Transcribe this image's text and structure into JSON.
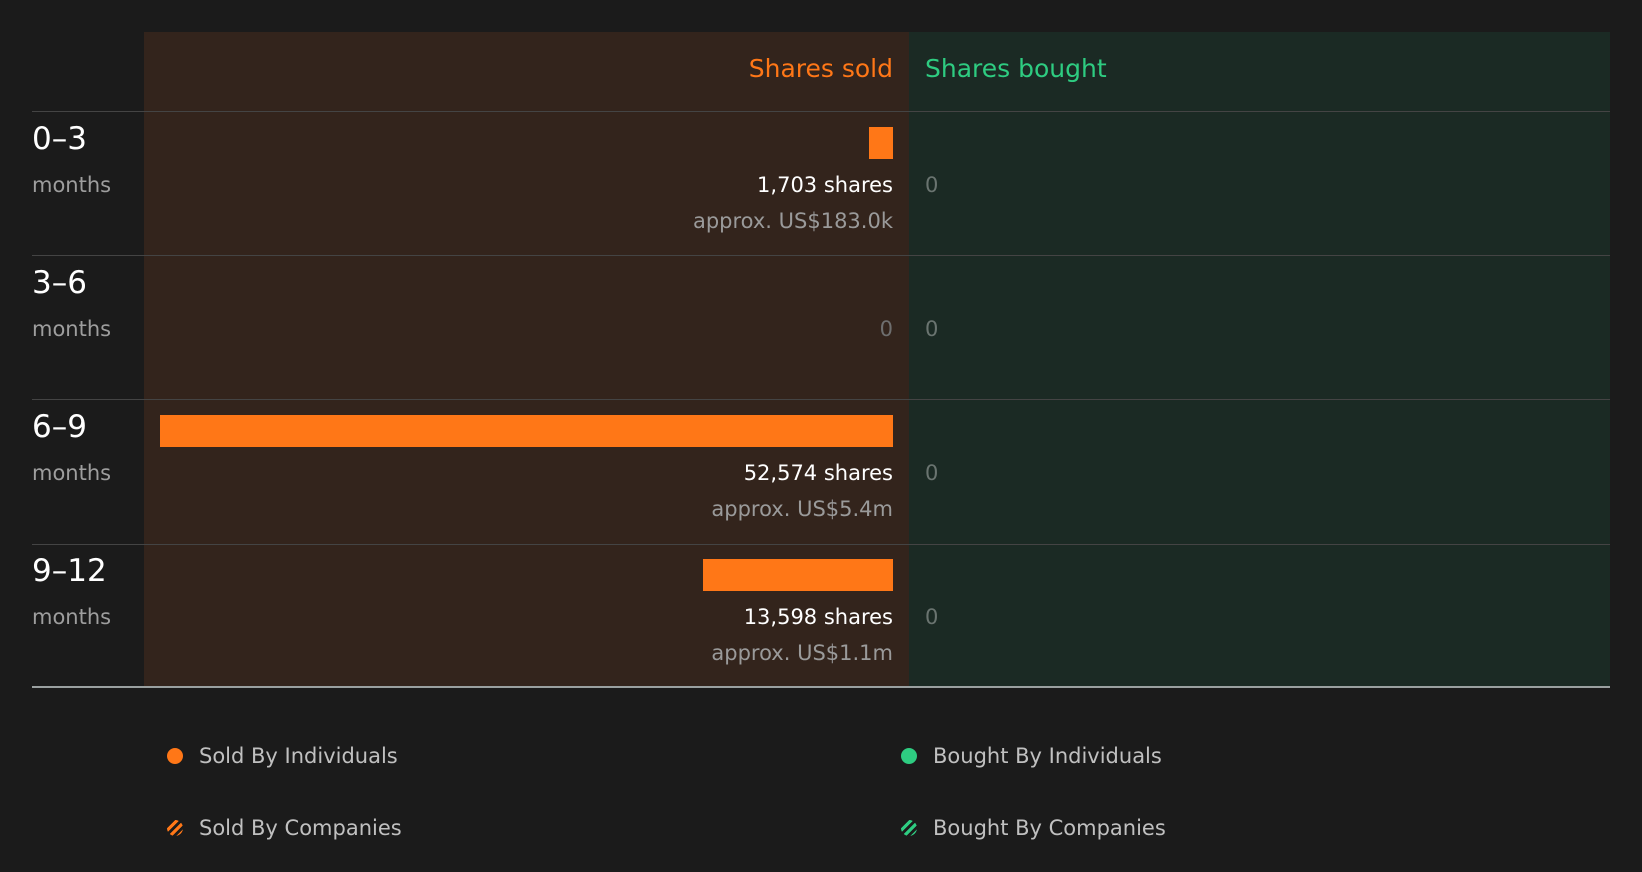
{
  "chart_data": {
    "type": "bar",
    "headers": {
      "sold": "Shares sold",
      "bought": "Shares bought"
    },
    "categories": [
      {
        "period": "0–3",
        "unit": "months"
      },
      {
        "period": "3–6",
        "unit": "months"
      },
      {
        "period": "6–9",
        "unit": "months"
      },
      {
        "period": "9–12",
        "unit": "months"
      }
    ],
    "sold": [
      {
        "shares": 1703,
        "shares_label": "1,703 shares",
        "value_label": "approx. US$183.0k"
      },
      {
        "shares": 0,
        "shares_label": "0",
        "value_label": ""
      },
      {
        "shares": 52574,
        "shares_label": "52,574 shares",
        "value_label": "approx. US$5.4m"
      },
      {
        "shares": 13598,
        "shares_label": "13,598 shares",
        "value_label": "approx. US$1.1m"
      }
    ],
    "bought": [
      {
        "shares": 0,
        "shares_label": "0"
      },
      {
        "shares": 0,
        "shares_label": "0"
      },
      {
        "shares": 0,
        "shares_label": "0"
      },
      {
        "shares": 0,
        "shares_label": "0"
      }
    ],
    "legend": [
      {
        "label": "Sold By Individuals",
        "marker": "dot",
        "color": "#ff7717"
      },
      {
        "label": "Bought By Individuals",
        "marker": "dot",
        "color": "#2ecc81"
      },
      {
        "label": "Sold By Companies",
        "marker": "hatch",
        "color": "#ff7717"
      },
      {
        "label": "Bought By Companies",
        "marker": "hatch",
        "color": "#2ecc81"
      }
    ],
    "colors": {
      "sold": "#ff7717",
      "bought": "#2ecc81",
      "background": "#1b1b1b",
      "sold_panel": "#33241c",
      "bought_panel": "#1b2a24"
    }
  }
}
